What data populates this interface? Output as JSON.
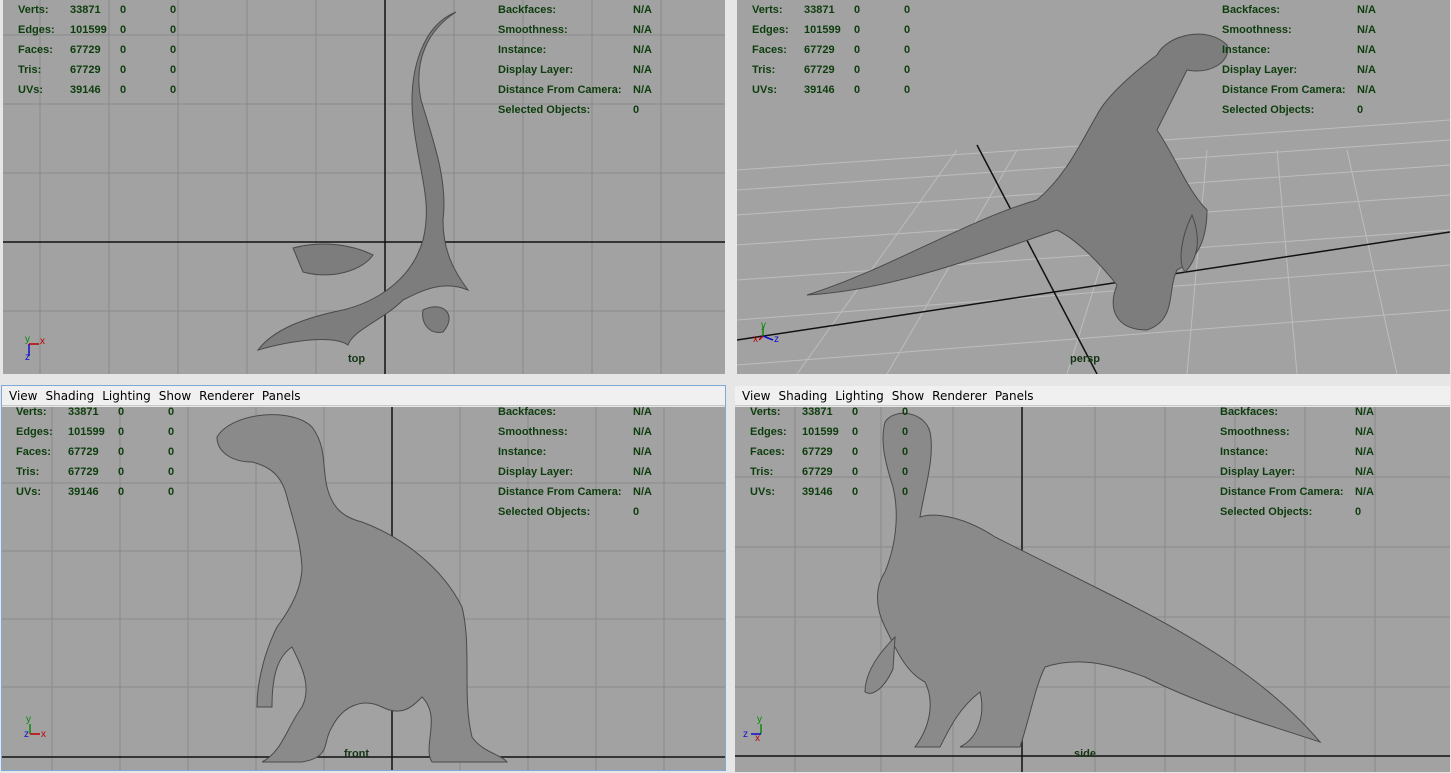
{
  "menus": [
    "View",
    "Shading",
    "Lighting",
    "Show",
    "Renderer",
    "Panels"
  ],
  "stats": {
    "rows": [
      {
        "label": "Verts:",
        "v1": "33871",
        "v2": "0",
        "v3": "0"
      },
      {
        "label": "Edges:",
        "v1": "101599",
        "v2": "0",
        "v3": "0"
      },
      {
        "label": "Faces:",
        "v1": "67729",
        "v2": "0",
        "v3": "0"
      },
      {
        "label": "Tris:",
        "v1": "67729",
        "v2": "0",
        "v3": "0"
      },
      {
        "label": "UVs:",
        "v1": "39146",
        "v2": "0",
        "v3": "0"
      }
    ]
  },
  "info": {
    "rows": [
      {
        "label": "Backfaces:",
        "value": "N/A"
      },
      {
        "label": "Smoothness:",
        "value": "N/A"
      },
      {
        "label": "Instance:",
        "value": "N/A"
      },
      {
        "label": "Display Layer:",
        "value": "N/A"
      },
      {
        "label": "Distance From Camera:",
        "value": "N/A"
      },
      {
        "label": "Selected Objects:",
        "value": "0"
      }
    ]
  },
  "panels": {
    "top": {
      "camera": "top"
    },
    "persp": {
      "camera": "persp"
    },
    "front": {
      "camera": "front"
    },
    "side": {
      "camera": "side"
    }
  },
  "axes": {
    "x": "x",
    "y": "y",
    "z": "z"
  },
  "colors": {
    "viewport_bg": "#a2a2a2",
    "grid": "#8a8a8a",
    "axis_line": "#111111",
    "hud_text": "#0d3d0d",
    "menu_bg": "#f0f0f0"
  }
}
